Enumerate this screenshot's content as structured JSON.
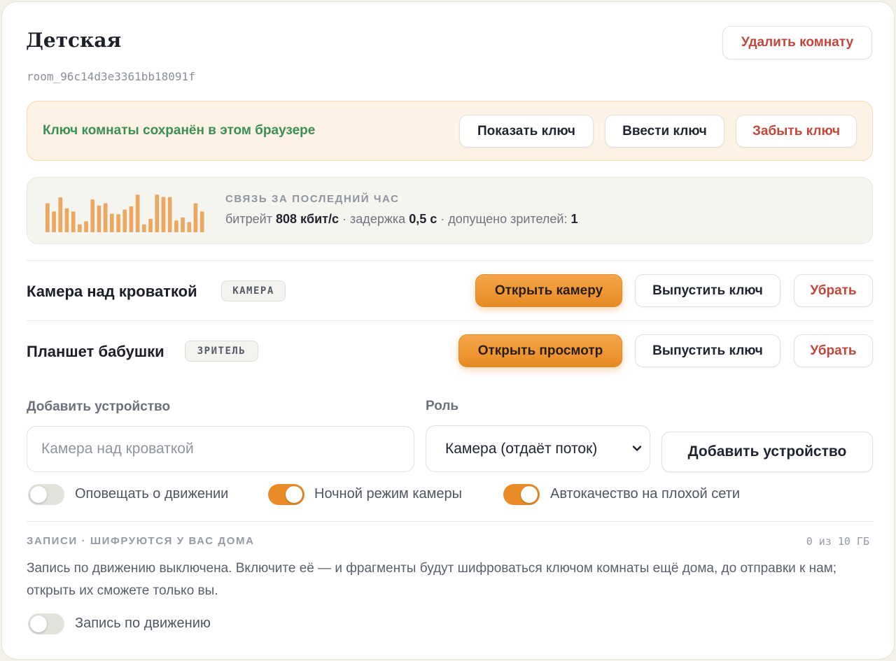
{
  "room": {
    "title": "Детская",
    "id": "room_96c14d3e3361bb18091f",
    "delete_label": "Удалить комнату"
  },
  "key": {
    "message": "Ключ комнаты сохранён в этом браузере",
    "show_label": "Показать ключ",
    "enter_label": "Ввести ключ",
    "forget_label": "Забыть ключ",
    "message_color": "#3a8f55"
  },
  "stats": {
    "heading": "СВЯЗЬ ЗА ПОСЛЕДНИЙ ЧАС",
    "bitrate_label": "битрейт",
    "bitrate_value": "808 кбит/с",
    "sep1": "·",
    "latency_label": "задержка",
    "latency_value": "0,5 с",
    "sep2": "·",
    "viewers_label": "допущено зрителей:",
    "viewers_value": "1",
    "sparkline": [
      0.74,
      0.53,
      0.89,
      0.61,
      0.53,
      0.2,
      0.28,
      0.84,
      0.68,
      0.74,
      0.47,
      0.46,
      0.58,
      0.66,
      0.96,
      0.2,
      0.34,
      0.96,
      0.9,
      0.9,
      0.3,
      0.38,
      0.26,
      0.74,
      0.53
    ],
    "bar_color": "#eba863"
  },
  "devices": [
    {
      "name": "Камера над кроваткой",
      "tag": "КАМЕРА",
      "primary_label": "Открыть камеру",
      "issue_key_label": "Выпустить ключ",
      "remove_label": "Убрать"
    },
    {
      "name": "Планшет бабушки",
      "tag": "ЗРИТЕЛЬ",
      "primary_label": "Открыть просмотр",
      "issue_key_label": "Выпустить ключ",
      "remove_label": "Убрать"
    }
  ],
  "add_device": {
    "name_label": "Добавить устройство",
    "name_placeholder": "Камера над кроваткой",
    "name_value": "",
    "role_label": "Роль",
    "role_selected": "Камера (отдаёт поток)",
    "submit_label": "Добавить устройство"
  },
  "toggles": [
    {
      "label": "Оповещать о движении",
      "on": false
    },
    {
      "label": "Ночной режим камеры",
      "on": true
    },
    {
      "label": "Автокачество на плохой сети",
      "on": true
    }
  ],
  "recordings": {
    "heading": "ЗАПИСИ · ШИФРУЮТСЯ У ВАС ДОМА",
    "storage": "0 из 10 ГБ",
    "description": "Запись по движению выключена. Включите её — и фрагменты будут шифроваться ключом комнаты ещё дома, до отправки к нам; открыть их сможете только вы.",
    "toggle_label": "Запись по движению",
    "toggle_on": false
  },
  "accent_color": "#ea8b27",
  "danger_color": "#c2473a"
}
